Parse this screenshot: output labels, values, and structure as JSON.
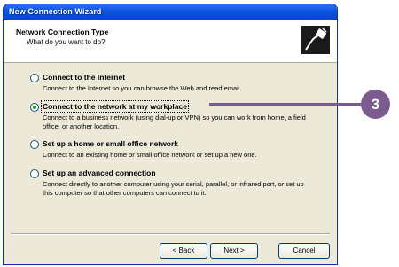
{
  "window": {
    "title": "New Connection Wizard"
  },
  "header": {
    "title": "Network Connection Type",
    "subtitle": "What do you want to do?"
  },
  "options": [
    {
      "label": "Connect to the Internet",
      "desc": "Connect to the Internet so you can browse the Web and read email.",
      "selected": false
    },
    {
      "label": "Connect to the network at my workplace",
      "desc": "Connect to a business network (using dial-up or VPN) so you can work from home, a field office, or another location.",
      "selected": true
    },
    {
      "label": "Set up a home or small office network",
      "desc": "Connect to an existing home or small office network or set up a new one.",
      "selected": false
    },
    {
      "label": "Set up an advanced connection",
      "desc": "Connect directly to another computer using your serial, parallel, or infrared port, or set up this computer so that other computers can connect to it.",
      "selected": false
    }
  ],
  "buttons": {
    "back": "< Back",
    "next": "Next >",
    "cancel": "Cancel"
  },
  "callout": {
    "number": "3"
  }
}
